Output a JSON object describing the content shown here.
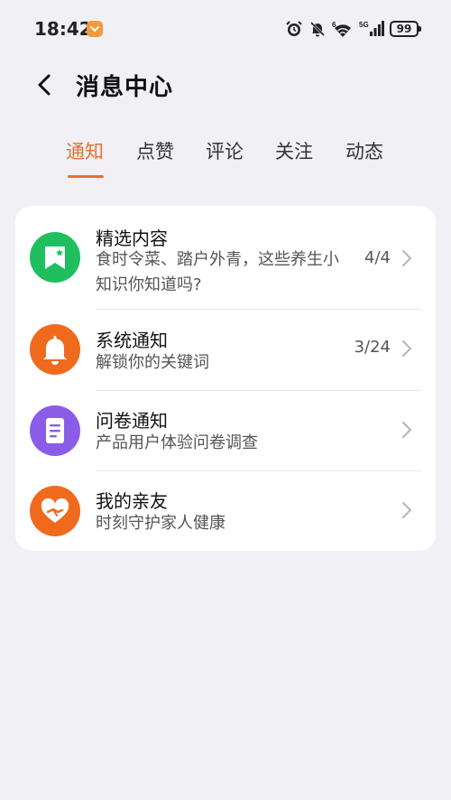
{
  "status_bar": {
    "time": "18:42",
    "battery": "99"
  },
  "header": {
    "title": "消息中心"
  },
  "tabs": [
    {
      "label": "通知",
      "active": true
    },
    {
      "label": "点赞",
      "active": false
    },
    {
      "label": "评论",
      "active": false
    },
    {
      "label": "关注",
      "active": false
    },
    {
      "label": "动态",
      "active": false
    }
  ],
  "messages": [
    {
      "title": "精选内容",
      "subtitle": "食时令菜、踏户外青，这些养生小知识你知道吗?",
      "count": "4/4",
      "icon": "featured-content-icon",
      "color": "#1fbf5f"
    },
    {
      "title": "系统通知",
      "subtitle": "解锁你的关键词",
      "count": "3/24",
      "icon": "bell-icon",
      "color": "#f06a1e"
    },
    {
      "title": "问卷通知",
      "subtitle": "产品用户体验问卷调查",
      "count": "",
      "icon": "survey-document-icon",
      "color": "#8b5ce8"
    },
    {
      "title": "我的亲友",
      "subtitle": "时刻守护家人健康",
      "count": "",
      "icon": "heart-hand-icon",
      "color": "#f06a1e"
    }
  ],
  "colors": {
    "accent": "#e8712f",
    "background": "#f0f0f5"
  }
}
